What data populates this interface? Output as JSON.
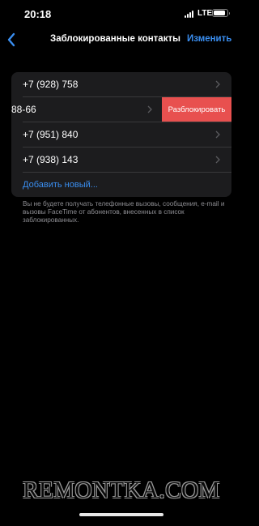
{
  "status_bar": {
    "time": "20:18",
    "network": "LTE",
    "battery_level": 0.85
  },
  "nav": {
    "back_icon": "chevron-left-icon",
    "title": "Заблокированные контакты",
    "edit_label": "Изменить"
  },
  "contacts": [
    {
      "number": "+7 (928) 758"
    },
    {
      "number": "88-66",
      "action_label": "Разблокировать"
    },
    {
      "number": "+7 (951) 840"
    },
    {
      "number": "+7 (938) 143"
    }
  ],
  "add_new_label": "Добавить новый...",
  "footer_text": "Вы не будете получать телефонные вызовы, сообщения, e-mail и вызовы FaceTime от абонентов, внесенных в список заблокированных.",
  "watermark": "REMONTKA.COM",
  "colors": {
    "background": "#000000",
    "cell_background": "#1c1c1e",
    "accent": "#3a8ef0",
    "destructive": "#e8504f",
    "secondary_text": "#8e8e93"
  }
}
